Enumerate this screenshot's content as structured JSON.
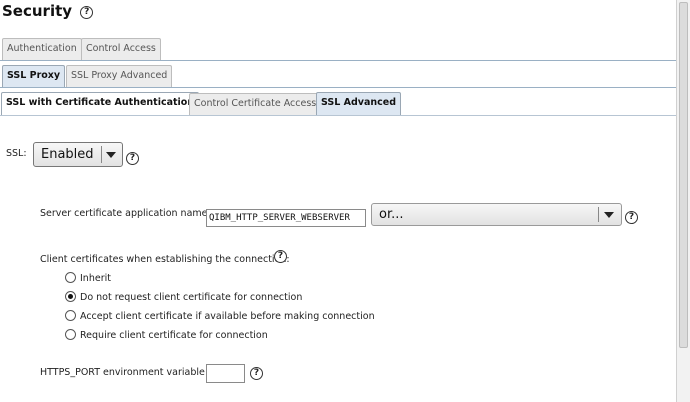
{
  "page": {
    "title": "Security"
  },
  "tabs_level1": [
    {
      "label": "Authentication",
      "active": false
    },
    {
      "label": "Control Access",
      "active": false
    }
  ],
  "tabs_level2": [
    {
      "label": "SSL Proxy",
      "active": true
    },
    {
      "label": "SSL Proxy Advanced",
      "active": false
    }
  ],
  "tabs_level3": [
    {
      "label": "SSL with Certificate Authentication",
      "active": true
    },
    {
      "label": "Control Certificate Access",
      "active": false
    },
    {
      "label": "SSL Advanced",
      "active": false
    }
  ],
  "ssl": {
    "label": "SSL:",
    "value": "Enabled"
  },
  "server_cert": {
    "label": "Server certificate application name:",
    "value": "QIBM_HTTP_SERVER_WEBSERVER",
    "or_select": "or..."
  },
  "client_certs": {
    "label": "Client certificates when establishing the connection:",
    "options": [
      {
        "label": "Inherit",
        "selected": false
      },
      {
        "label": "Do not request client certificate for connection",
        "selected": true
      },
      {
        "label": "Accept client certificate if available before making connection",
        "selected": false
      },
      {
        "label": "Require client certificate for connection",
        "selected": false
      }
    ]
  },
  "https_port": {
    "label": "HTTPS_PORT environment variable:",
    "value": ""
  },
  "help_glyph": "?"
}
